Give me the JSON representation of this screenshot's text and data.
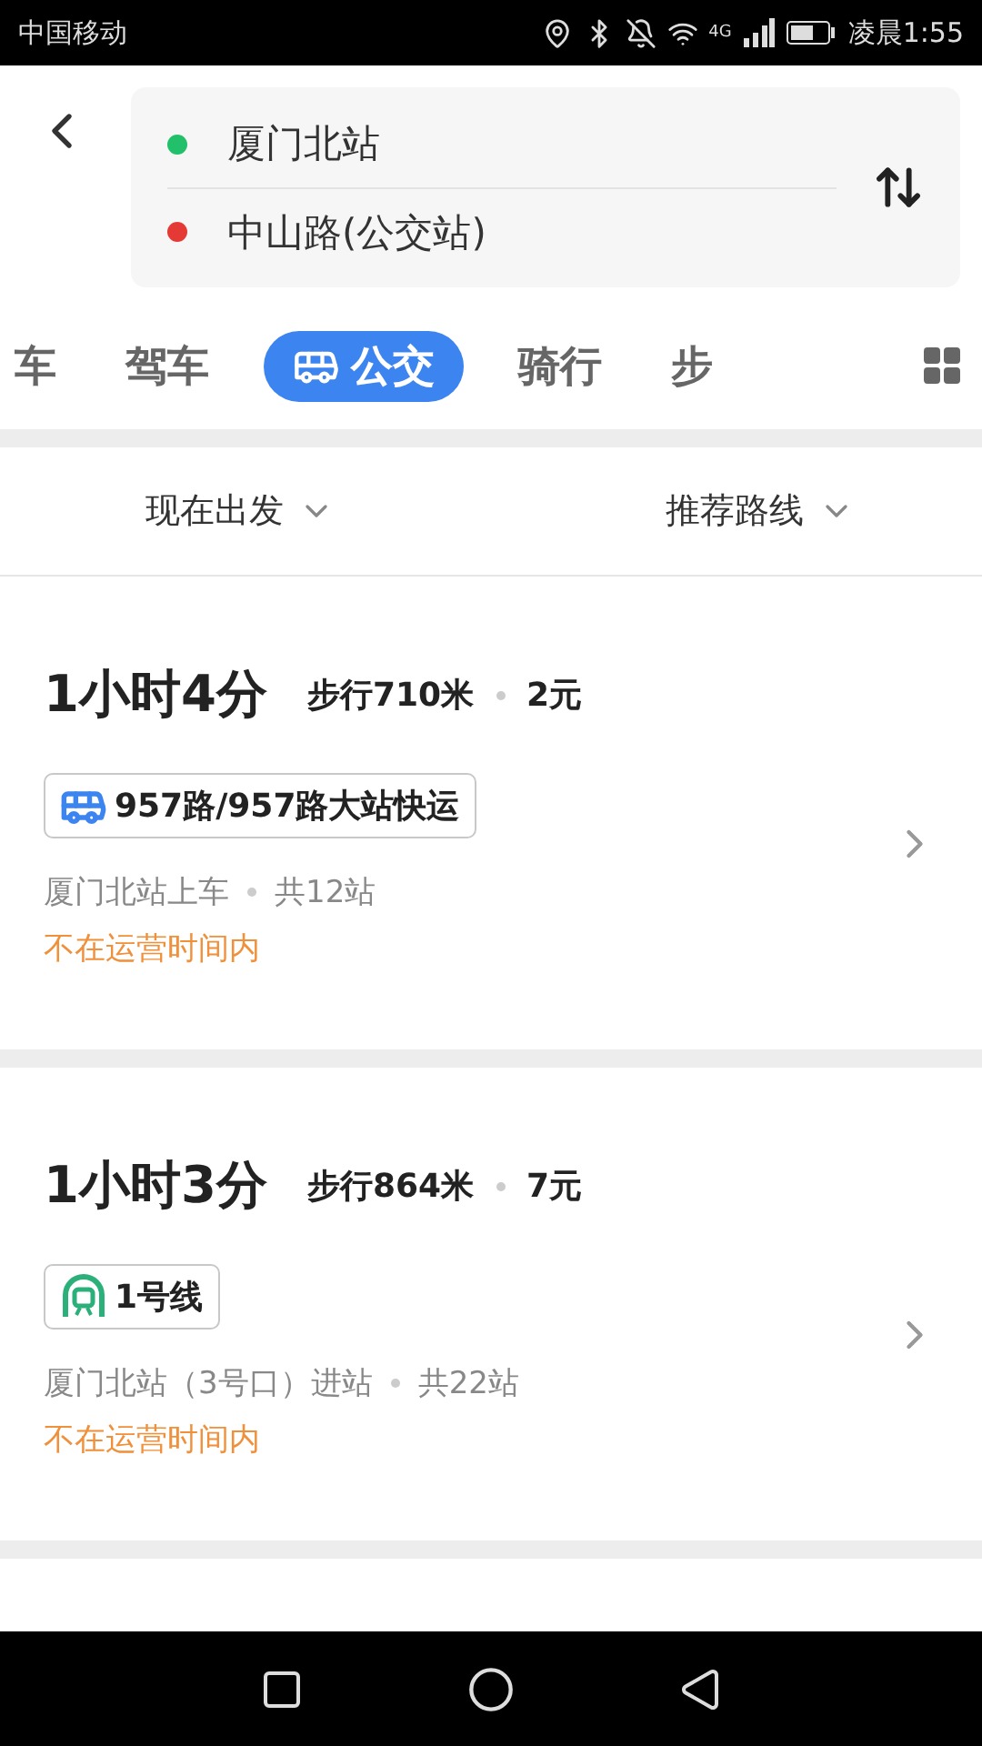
{
  "status_bar": {
    "carrier": "中国移动",
    "time": "凌晨1:55",
    "network": "4G"
  },
  "route_input": {
    "origin": "厦门北站",
    "destination": "中山路(公交站)"
  },
  "tabs": [
    {
      "label": "车",
      "kind": "text",
      "selected": false
    },
    {
      "label": "驾车",
      "kind": "text",
      "selected": false
    },
    {
      "label": "公交",
      "kind": "bus",
      "selected": true
    },
    {
      "label": "骑行",
      "kind": "text",
      "selected": false
    },
    {
      "label": "步",
      "kind": "text",
      "selected": false
    }
  ],
  "filters": [
    {
      "label": "现在出发"
    },
    {
      "label": "推荐路线"
    }
  ],
  "routes": [
    {
      "duration": "1小时4分",
      "walk": "步行710米",
      "fare": "2元",
      "line": {
        "kind": "bus",
        "name": "957路/957路大站快运"
      },
      "boarding": "厦门北站上车",
      "stops": "共12站",
      "notice": "不在运营时间内"
    },
    {
      "duration": "1小时3分",
      "walk": "步行864米",
      "fare": "7元",
      "line": {
        "kind": "subway",
        "name": "1号线"
      },
      "boarding": "厦门北站（3号口）进站",
      "stops": "共22站",
      "notice": "不在运营时间内"
    }
  ]
}
